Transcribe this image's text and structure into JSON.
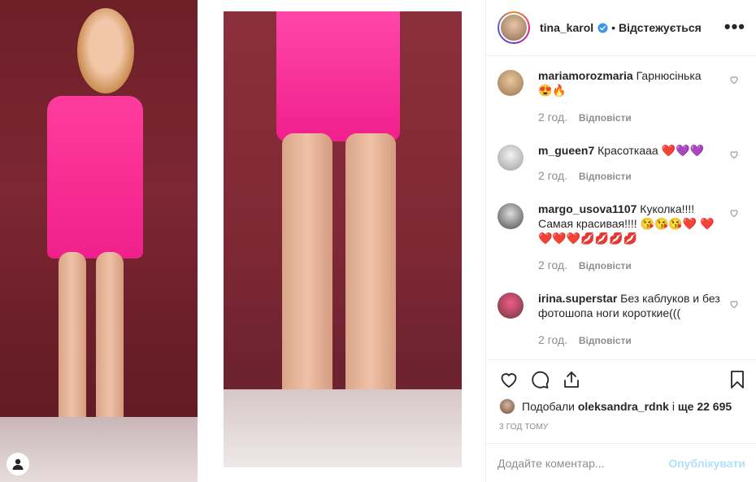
{
  "post": {
    "author": {
      "username": "tina_karol",
      "verified": true,
      "follow_state": "Відстежується",
      "separator": "•"
    },
    "more_label": "•••",
    "comments": [
      {
        "username": "mariamorozmaria",
        "text": "Гарнюсінька",
        "emoji": "😍🔥",
        "time": "2 год.",
        "reply": "Відповісти"
      },
      {
        "username": "m_gueen7",
        "text": "Красоткааа",
        "emoji": "❤️💜💜",
        "time": "2 год.",
        "reply": "Відповісти"
      },
      {
        "username": "margo_usova1107",
        "text": "Куколка!!!! Самая красивая!!!!",
        "emoji": "😘😘😘❤️ ❤️❤️❤️❤️💋💋💋💋",
        "time": "2 год.",
        "reply": "Відповісти"
      },
      {
        "username": "irina.superstar",
        "text": "Без каблуков и без фотошопа ноги короткие(((",
        "emoji": "",
        "time": "2 год.",
        "reply": "Відповісти"
      }
    ],
    "likes": {
      "prefix": "Подобали",
      "user": "oleksandra_rdnk",
      "connector": "і",
      "others": "ще 22 695"
    },
    "time_ago": "3 ГОД ТОМУ",
    "add_comment": {
      "placeholder": "Додайте коментар...",
      "publish": "Опублікувати"
    },
    "icons": {
      "like": "heart-icon",
      "comment": "comment-icon",
      "share": "share-icon",
      "save": "bookmark-icon",
      "tagged_user": "user-icon"
    },
    "colors": {
      "accent": "#0095f6",
      "publish_disabled": "#b2dffc",
      "verified": "#3897f0",
      "dress": "#f0208a"
    }
  }
}
